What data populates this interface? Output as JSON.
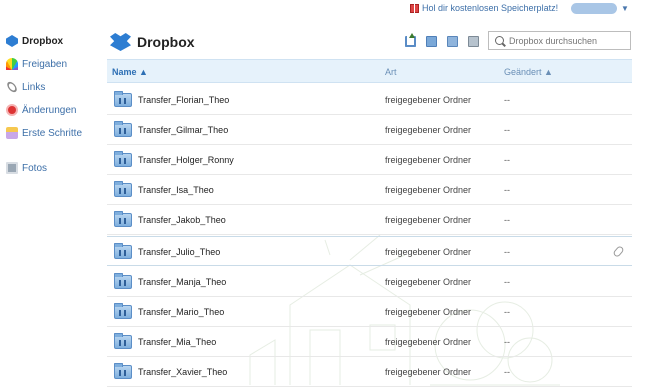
{
  "topbar": {
    "promo_label": "Hol dir kostenlosen Speicherplatz!",
    "promo_icon": "gift-icon"
  },
  "sidebar": {
    "items": [
      {
        "label": "Dropbox",
        "icon": "dropbox-icon",
        "active": true
      },
      {
        "label": "Freigaben",
        "icon": "rainbow-icon"
      },
      {
        "label": "Links",
        "icon": "link-icon"
      },
      {
        "label": "Änderungen",
        "icon": "history-icon"
      },
      {
        "label": "Erste Schritte",
        "icon": "getting-started-icon"
      },
      {
        "label": "Fotos",
        "icon": "photos-icon"
      }
    ]
  },
  "header": {
    "title": "Dropbox",
    "toolbar": [
      "upload-icon",
      "new-folder-icon",
      "share-folder-icon",
      "show-deleted-icon"
    ]
  },
  "search": {
    "placeholder": "Dropbox durchsuchen"
  },
  "table": {
    "columns": {
      "name": "Name ▲",
      "kind": "Art",
      "modified": "Geändert ▲"
    },
    "rows": [
      {
        "name": "Transfer_Florian_Theo",
        "kind": "freigegebener Ordner",
        "modified": "--"
      },
      {
        "name": "Transfer_Gilmar_Theo",
        "kind": "freigegebener Ordner",
        "modified": "--"
      },
      {
        "name": "Transfer_Holger_Ronny",
        "kind": "freigegebener Ordner",
        "modified": "--"
      },
      {
        "name": "Transfer_Isa_Theo",
        "kind": "freigegebener Ordner",
        "modified": "--"
      },
      {
        "name": "Transfer_Jakob_Theo",
        "kind": "freigegebener Ordner",
        "modified": "--"
      },
      {
        "name": "Transfer_Julio_Theo",
        "kind": "freigegebener Ordner",
        "modified": "--",
        "highlighted": true
      },
      {
        "name": "Transfer_Manja_Theo",
        "kind": "freigegebener Ordner",
        "modified": "--"
      },
      {
        "name": "Transfer_Mario_Theo",
        "kind": "freigegebener Ordner",
        "modified": "--"
      },
      {
        "name": "Transfer_Mia_Theo",
        "kind": "freigegebener Ordner",
        "modified": "--"
      },
      {
        "name": "Transfer_Xavier_Theo",
        "kind": "freigegebener Ordner",
        "modified": "--"
      }
    ]
  },
  "colors": {
    "link": "#3d6fa8",
    "header_bg": "#e6f2fb",
    "brand": "#2d7dd2"
  }
}
